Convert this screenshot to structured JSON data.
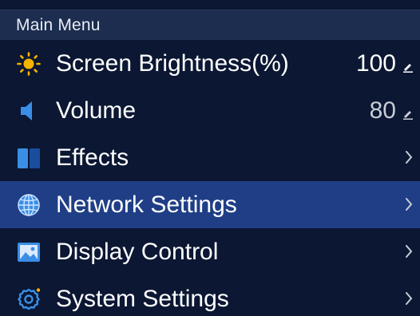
{
  "header": {
    "title": "Main Menu"
  },
  "menu": {
    "items": [
      {
        "label": "Screen Brightness(%)",
        "value": "100",
        "icon": "sun-icon",
        "action": "edit"
      },
      {
        "label": "Volume",
        "value": "80",
        "icon": "speaker-icon",
        "action": "edit"
      },
      {
        "label": "Effects",
        "icon": "effects-icon",
        "action": "chevron"
      },
      {
        "label": "Network Settings",
        "icon": "globe-icon",
        "action": "chevron",
        "selected": true
      },
      {
        "label": "Display Control",
        "icon": "image-icon",
        "action": "chevron"
      },
      {
        "label": "System Settings",
        "icon": "gear-icon",
        "action": "chevron"
      }
    ]
  },
  "colors": {
    "background": "#0b1733",
    "header": "#1d2d4f",
    "selected": "#1f3e86",
    "accent_blue": "#3a8ee6",
    "sun": "#f5b400"
  }
}
